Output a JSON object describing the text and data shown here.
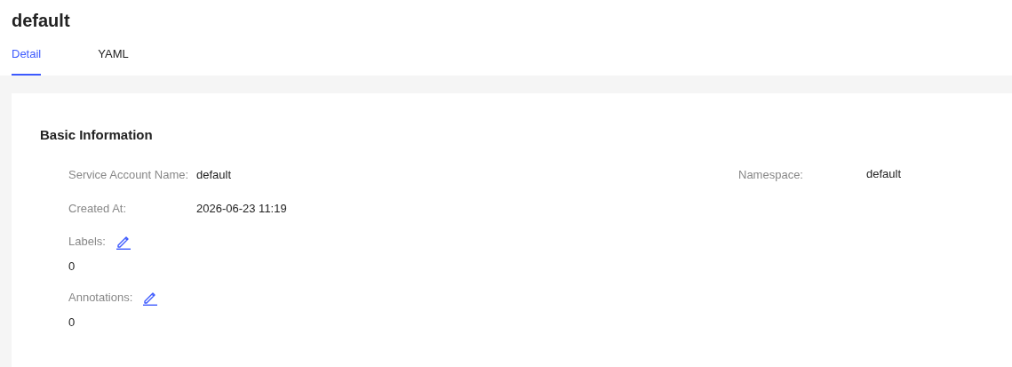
{
  "title": "default",
  "tabs": [
    {
      "label": "Detail",
      "selected": true
    },
    {
      "label": "YAML",
      "selected": false
    }
  ],
  "section": {
    "heading": "Basic Information",
    "fields": [
      {
        "label": "Service Account Name:",
        "value": "default",
        "label2": "Namespace:",
        "value2": "default"
      },
      {
        "label": "Created At:",
        "value": "2026-06-23 11:19"
      }
    ],
    "editables": [
      {
        "label": "Labels:",
        "count": "0"
      },
      {
        "label": "Annotations:",
        "count": "0"
      }
    ]
  }
}
